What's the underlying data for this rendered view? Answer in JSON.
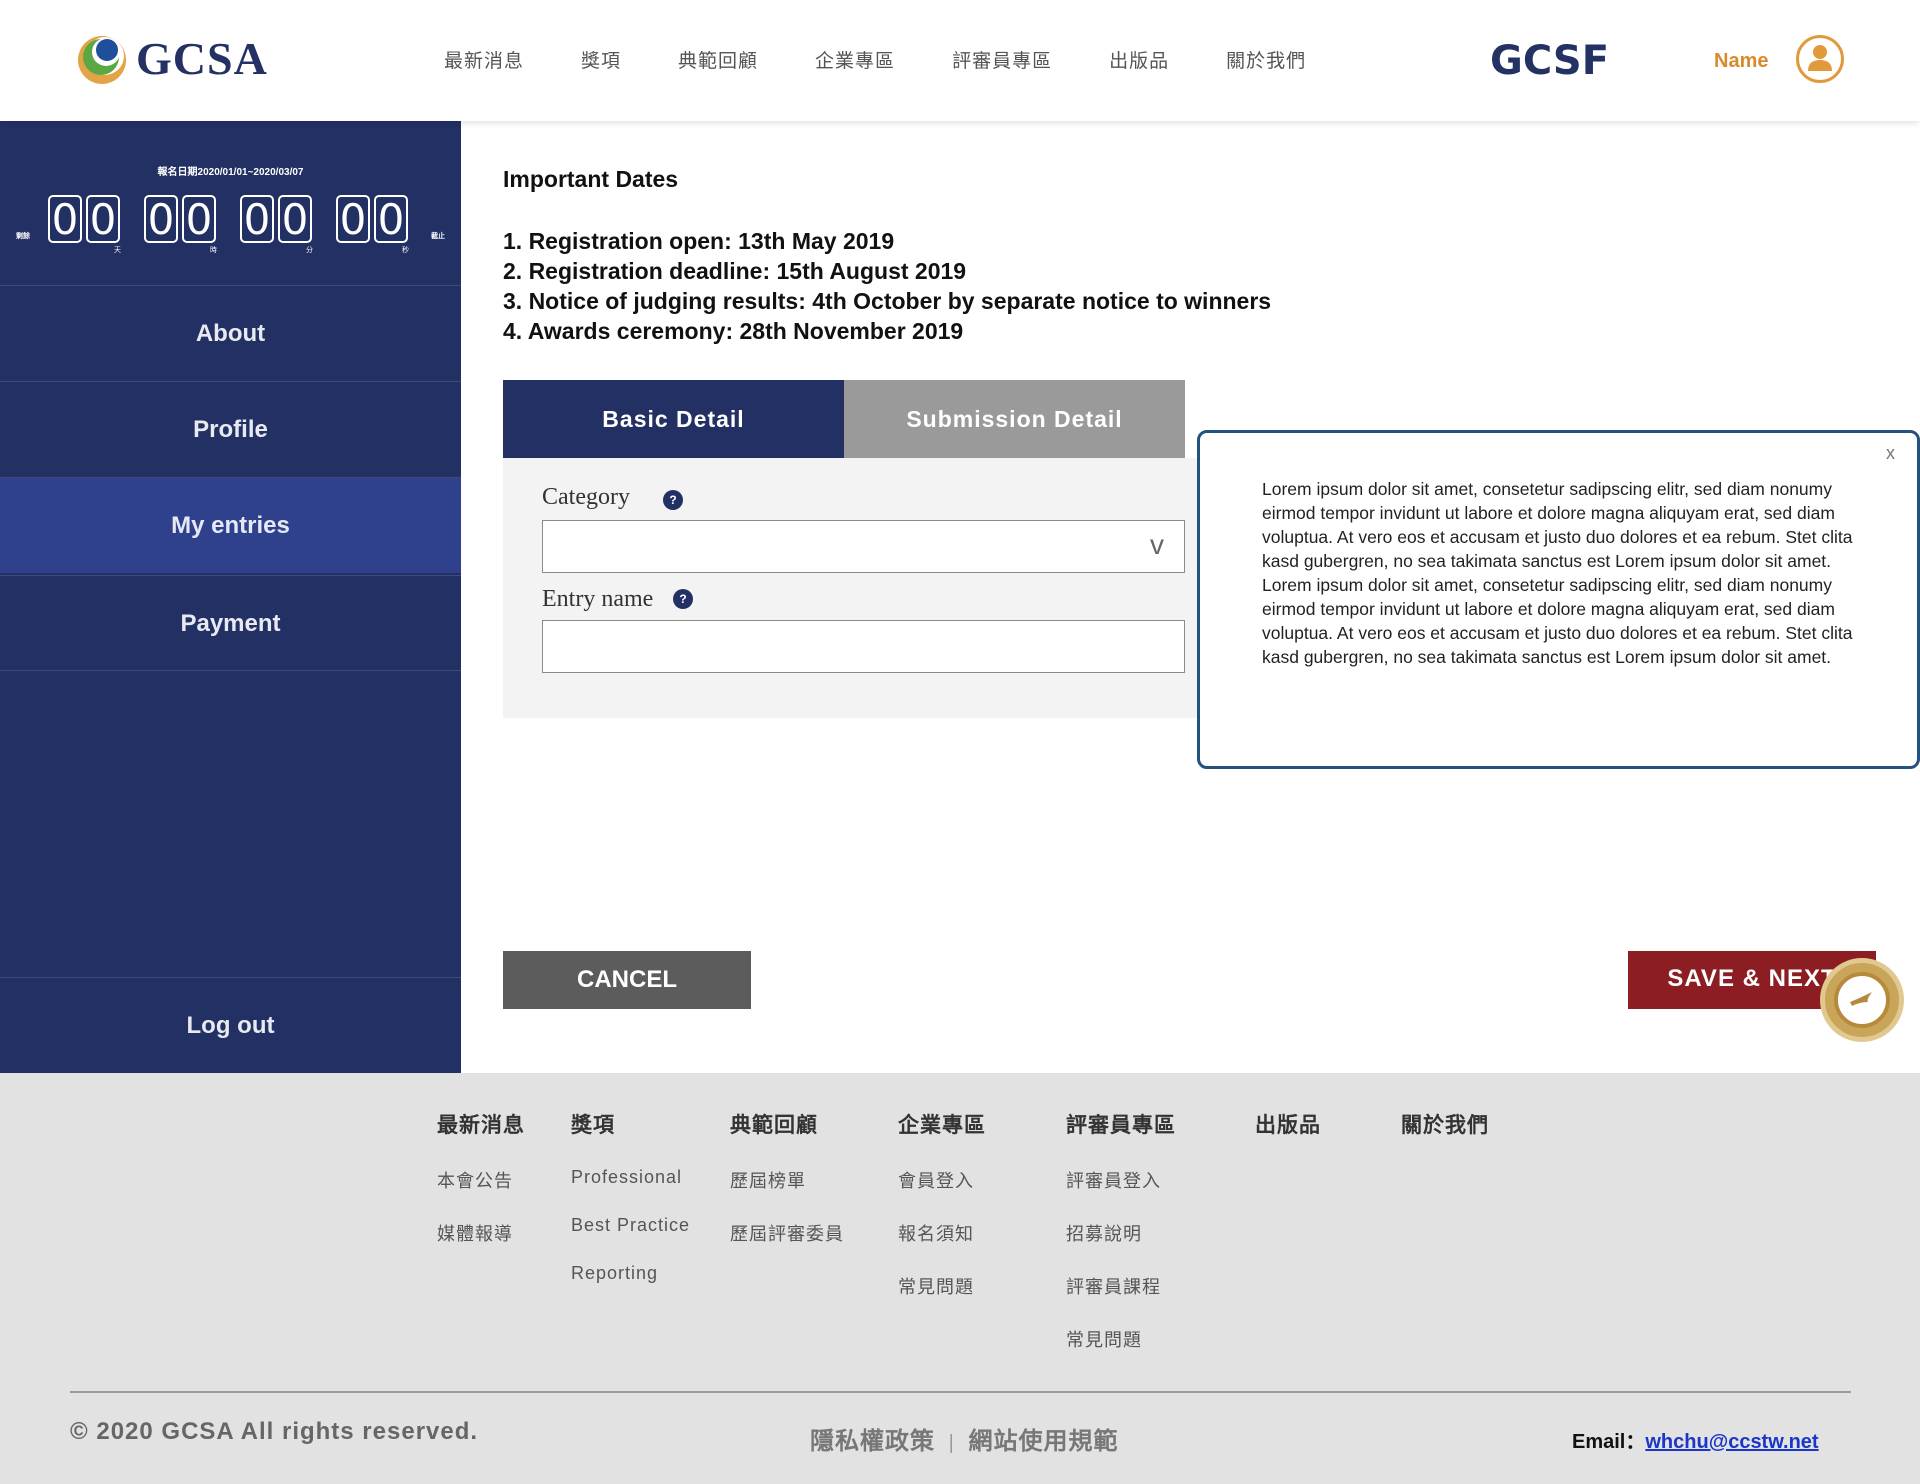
{
  "header": {
    "logo_text": "GCSA",
    "nav": [
      "最新消息",
      "獎項",
      "典範回顧",
      "企業專區",
      "評審員專區",
      "出版品",
      "關於我們"
    ],
    "gcsf_logo": "GCSF",
    "user_name": "Name",
    "avatar_icon": "user-icon"
  },
  "sidebar": {
    "registration_date": "報名日期2020/01/01~2020/03/07",
    "countdown": {
      "start_label": "剩餘",
      "end_label": "截止",
      "units": [
        "天",
        "時",
        "分",
        "秒"
      ],
      "digits": [
        "0",
        "0",
        "0",
        "0",
        "0",
        "0",
        "0",
        "0"
      ]
    },
    "items": [
      {
        "label": "About"
      },
      {
        "label": "Profile"
      },
      {
        "label": "My entries"
      },
      {
        "label": "Payment"
      }
    ],
    "logout": "Log out",
    "active_item": "My entries"
  },
  "main": {
    "dates_title": "Important Dates",
    "dates": [
      "1. Registration open: 13th May 2019",
      "2. Registration deadline: 15th August 2019",
      "3. Notice of judging results: 4th October by separate notice to winners",
      "4. Awards ceremony: 28th November 2019"
    ],
    "tabs": [
      {
        "label": "Basic Detail"
      },
      {
        "label": "Submission Detail"
      }
    ],
    "form": {
      "category_label": "Category",
      "category_value": "",
      "entry_name_label": "Entry name",
      "entry_name_value": ""
    },
    "tooltip": {
      "close": "x",
      "text": "Lorem ipsum dolor sit amet, consetetur sadipscing elitr, sed diam nonumy eirmod tempor invidunt ut labore et dolore magna aliquyam erat, sed diam voluptua. At vero eos et accusam et justo duo dolores et ea rebum. Stet clita kasd gubergren, no sea takimata sanctus est Lorem ipsum dolor sit amet. Lorem ipsum dolor sit amet, consetetur sadipscing elitr, sed diam nonumy eirmod tempor invidunt ut labore et dolore magna aliquyam erat, sed diam voluptua. At vero eos et accusam et justo duo dolores et ea rebum. Stet clita kasd gubergren, no sea takimata sanctus est Lorem ipsum dolor sit amet."
    },
    "cancel_label": "CANCEL",
    "save_label": "SAVE & NEXT"
  },
  "footer": {
    "columns": [
      {
        "head": "最新消息",
        "links": [
          "本會公告",
          "媒體報導"
        ]
      },
      {
        "head": "獎項",
        "links": [
          "Professional",
          "Best Practice",
          "Reporting"
        ]
      },
      {
        "head": "典範回顧",
        "links": [
          "歷屆榜單",
          "歷屆評審委員"
        ]
      },
      {
        "head": "企業專區",
        "links": [
          "會員登入",
          "報名須知",
          "常見問題"
        ]
      },
      {
        "head": "評審員專區",
        "links": [
          "評審員登入",
          "招募說明",
          "評審員課程",
          "常見問題"
        ]
      },
      {
        "head": "出版品",
        "links": []
      },
      {
        "head": "關於我們",
        "links": []
      }
    ],
    "copyright": "© 2020 GCSA All rights reserved.",
    "privacy": "隱私權政策",
    "separator": "|",
    "terms": "網站使用規範",
    "email_label": "Email：",
    "email": "whchu@ccstw.net"
  },
  "colors": {
    "navy": "#233063",
    "active": "#2f418d",
    "accent_orange": "#d98a2a",
    "save_red": "#8b1d23",
    "link_blue": "#1a35c9"
  }
}
